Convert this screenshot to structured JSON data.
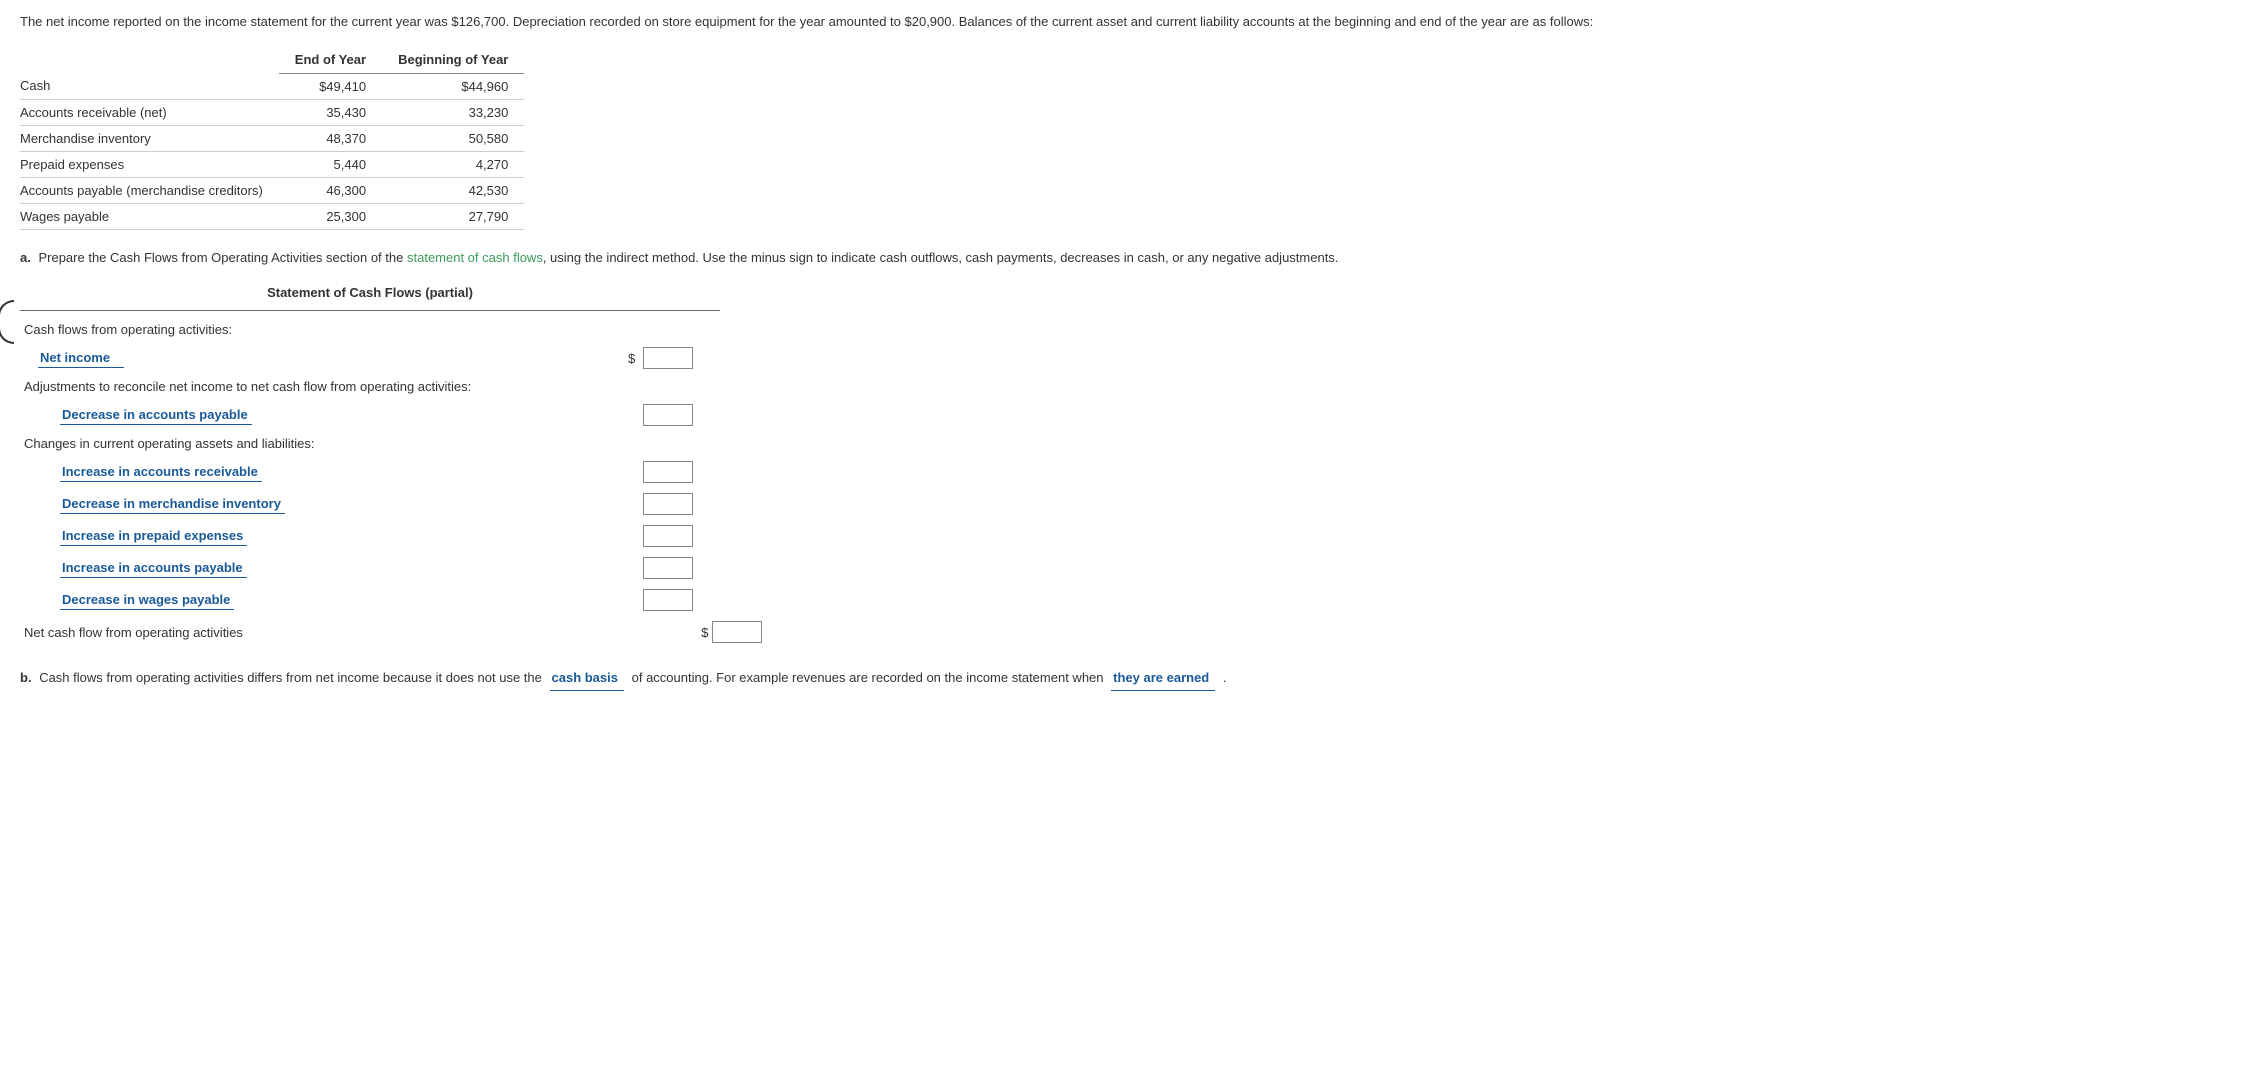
{
  "intro": "The net income reported on the income statement for the current year was $126,700. Depreciation recorded on store equipment for the year amounted to $20,900. Balances of the current asset and current liability accounts at the beginning and end of the year are as follows:",
  "balances": {
    "headers": {
      "end": "End of Year",
      "begin": "Beginning of Year"
    },
    "rows": [
      {
        "label": "Cash",
        "end": "$49,410",
        "begin": "$44,960"
      },
      {
        "label": "Accounts receivable (net)",
        "end": "35,430",
        "begin": "33,230"
      },
      {
        "label": "Merchandise inventory",
        "end": "48,370",
        "begin": "50,580"
      },
      {
        "label": "Prepaid expenses",
        "end": "5,440",
        "begin": "4,270"
      },
      {
        "label": "Accounts payable (merchandise creditors)",
        "end": "46,300",
        "begin": "42,530"
      },
      {
        "label": "Wages payable",
        "end": "25,300",
        "begin": "27,790"
      }
    ]
  },
  "partA": {
    "label": "a.",
    "text_pre": "Prepare the Cash Flows from Operating Activities section of the ",
    "link": "statement of cash flows",
    "text_post": ", using the indirect method. Use the minus sign to indicate cash outflows, cash payments, decreases in cash, or any negative adjustments."
  },
  "stmt": {
    "title": "Statement of Cash Flows (partial)",
    "heading1": "Cash flows from operating activities:",
    "line_netincome": "Net income",
    "heading2": "Adjustments to reconcile net income to net cash flow from operating activities:",
    "line_adj1": "Decrease in accounts payable",
    "heading3": "Changes in current operating assets and liabilities:",
    "line_chg1": "Increase in accounts receivable",
    "line_chg2": "Decrease in merchandise inventory",
    "line_chg3": "Increase in prepaid expenses",
    "line_chg4": "Increase in accounts payable",
    "line_chg5": "Decrease in wages payable",
    "footer": "Net cash flow from operating activities",
    "dollar": "$"
  },
  "partB": {
    "label": "b.",
    "text1": "Cash flows from operating activities differs from net income because it does not use the",
    "dd1": "cash basis",
    "text2": "of accounting. For example revenues are recorded on the income statement when",
    "dd2": "they are earned",
    "period": "."
  }
}
